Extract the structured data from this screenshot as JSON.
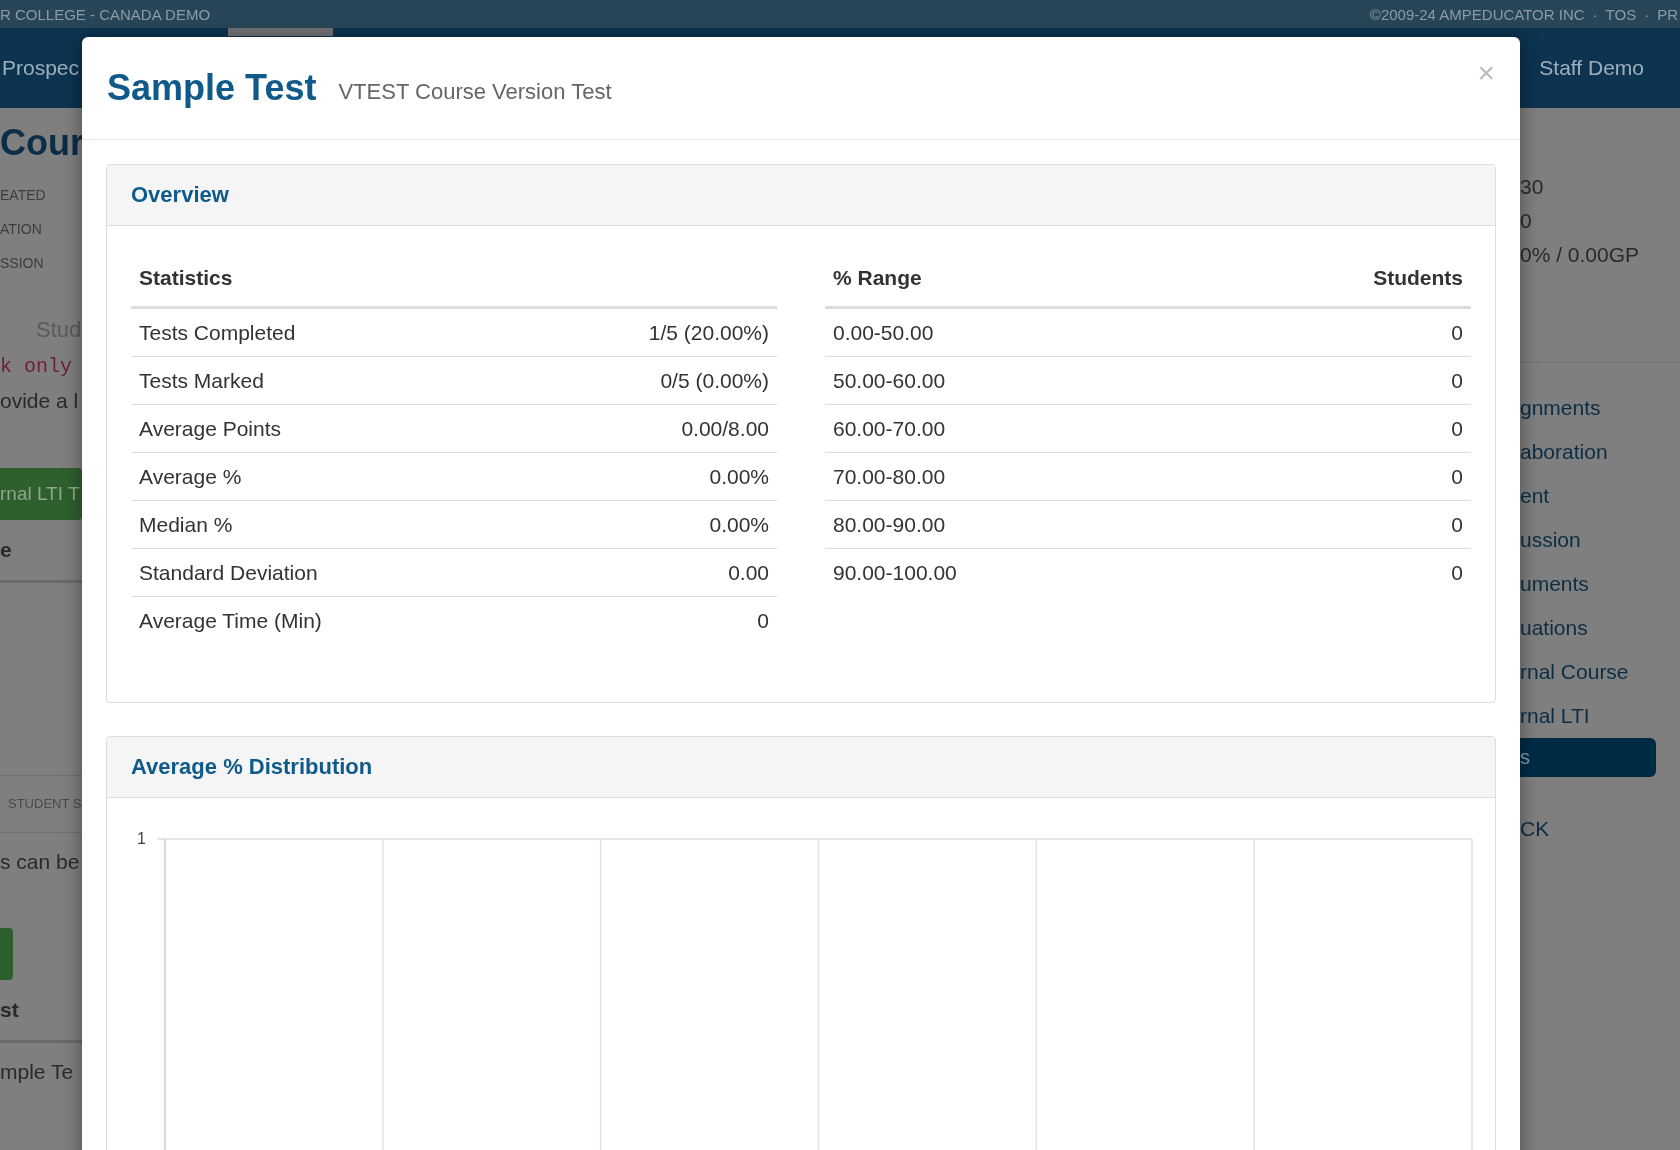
{
  "top_bar": {
    "left": "R COLLEGE - CANADA DEMO",
    "links": [
      "©2009-24 AMPEDUCATOR INC",
      "·",
      "TOS",
      "·",
      "PR"
    ]
  },
  "nav": {
    "left": "Prospec",
    "right": "Staff Demo"
  },
  "background_left": [
    {
      "kind": "heading",
      "text": "Cour"
    },
    {
      "kind": "label",
      "text": "EATED"
    },
    {
      "kind": "label",
      "text": "ATION"
    },
    {
      "kind": "label",
      "text": "SSION"
    },
    {
      "kind": "tab",
      "text": "Stud"
    },
    {
      "kind": "code",
      "text": "k only"
    },
    {
      "kind": "text",
      "text": "ovide a l"
    },
    {
      "kind": "button",
      "text": "rnal LTI T"
    },
    {
      "kind": "bold",
      "text": "e"
    },
    {
      "kind": "caps",
      "text": "STUDENT S"
    },
    {
      "kind": "text",
      "text": "s can be"
    },
    {
      "kind": "button"
    },
    {
      "kind": "bold",
      "text": "st"
    },
    {
      "kind": "text",
      "text": "mple Te"
    }
  ],
  "background_right": [
    {
      "kind": "value",
      "text": "30"
    },
    {
      "kind": "value",
      "text": "0"
    },
    {
      "kind": "value",
      "text": "0% / 0.00GP"
    },
    {
      "kind": "link",
      "text": "gnments"
    },
    {
      "kind": "link",
      "text": "aboration"
    },
    {
      "kind": "link",
      "text": "ent"
    },
    {
      "kind": "link",
      "text": "ussion"
    },
    {
      "kind": "link",
      "text": "uments"
    },
    {
      "kind": "link",
      "text": "uations"
    },
    {
      "kind": "link",
      "text": "rnal Course"
    },
    {
      "kind": "link",
      "text": "rnal LTI"
    },
    {
      "kind": "button",
      "text": "s"
    },
    {
      "kind": "link",
      "text": "CK"
    }
  ],
  "modal": {
    "title": "Sample Test",
    "subtitle": "VTEST Course Version Test",
    "close": "×",
    "overview": {
      "title": "Overview",
      "statistics": {
        "columns": [
          "Statistics"
        ],
        "rows": [
          [
            "Tests Completed",
            "1/5 (20.00%)"
          ],
          [
            "Tests Marked",
            "0/5 (0.00%)"
          ],
          [
            "Average Points",
            "0.00/8.00"
          ],
          [
            "Average %",
            "0.00%"
          ],
          [
            "Median %",
            "0.00%"
          ],
          [
            "Standard Deviation",
            "0.00"
          ],
          [
            "Average Time (Min)",
            "0"
          ]
        ]
      },
      "ranges": {
        "columns": [
          "% Range",
          "Students"
        ],
        "rows": [
          [
            "0.00-50.00",
            "0"
          ],
          [
            "50.00-60.00",
            "0"
          ],
          [
            "60.00-70.00",
            "0"
          ],
          [
            "70.00-80.00",
            "0"
          ],
          [
            "80.00-90.00",
            "0"
          ],
          [
            "90.00-100.00",
            "0"
          ]
        ]
      }
    },
    "distribution": {
      "title": "Average % Distribution",
      "y_tick": "1"
    }
  }
}
